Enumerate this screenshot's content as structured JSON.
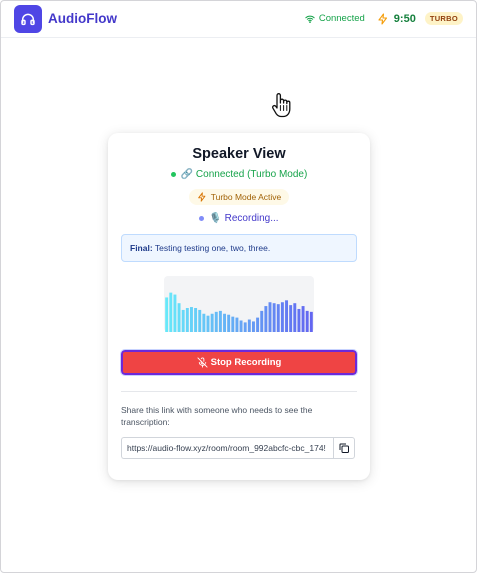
{
  "app": {
    "name": "AudioFlow",
    "logo_icon": "headphones-icon",
    "accent": "#4f46e5"
  },
  "header": {
    "connection_status": "Connected",
    "time": "9:50",
    "mode_badge": "TURBO"
  },
  "card": {
    "title": "Speaker View",
    "status": "🔗 Connected (Turbo Mode)",
    "turbo_label": "Turbo Mode Active",
    "recording_label": "🎙️ Recording...",
    "final_prefix": "Final:",
    "final_text": "Testing testing one, two, three.",
    "waveform_levels": [
      0.72,
      0.82,
      0.78,
      0.6,
      0.46,
      0.5,
      0.52,
      0.5,
      0.46,
      0.38,
      0.34,
      0.38,
      0.42,
      0.44,
      0.38,
      0.36,
      0.32,
      0.3,
      0.24,
      0.2,
      0.26,
      0.22,
      0.3,
      0.44,
      0.54,
      0.62,
      0.6,
      0.58,
      0.62,
      0.66,
      0.56,
      0.6,
      0.48,
      0.54,
      0.44,
      0.42
    ],
    "stop_button": "Stop Recording",
    "share_text": "Share this link with someone who needs to see the transcription:",
    "share_link": "https://audio-flow.xyz/room/room_992abcfc-cbc_174!"
  },
  "colors": {
    "status_green": "#16a34a",
    "stop_red": "#ef4444",
    "wave_start": "#67e8f9",
    "wave_end": "#6366f1"
  }
}
